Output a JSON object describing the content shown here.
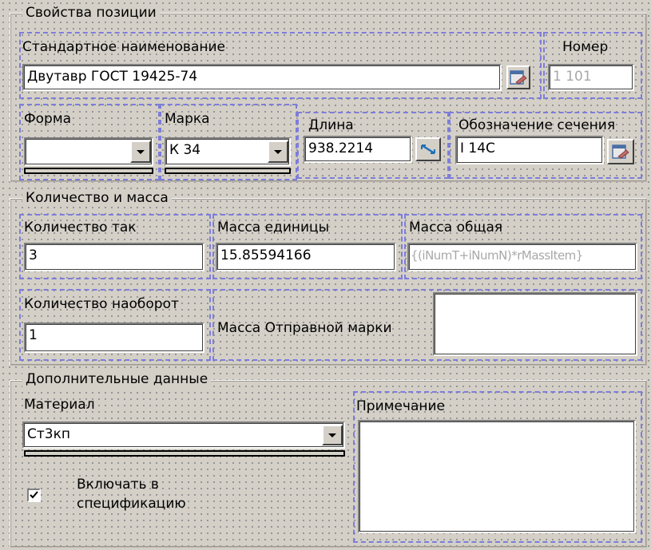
{
  "position": {
    "title": "Свойства позиции",
    "std_name_label": "Стандартное наименование",
    "std_name_value": "Двутавр ГОСТ 19425-74",
    "number_label": "Номер",
    "number_value": "1 101",
    "form_label": "Форма",
    "form_value": "",
    "mark_label": "Марка",
    "mark_value": "К 34",
    "length_label": "Длина",
    "length_value": "938.2214",
    "section_label": "Обозначение сечения",
    "section_value": "I 14С"
  },
  "quantity": {
    "title": "Количество и масса",
    "qty_label": "Количество так",
    "qty_value": "3",
    "unit_mass_label": "Масса единицы",
    "unit_mass_value": "15.85594166",
    "total_mass_label": "Масса общая",
    "total_mass_value": "{(iNumT+iNumN)*rMassItem}",
    "qty_rev_label": "Количество наоборот",
    "qty_rev_value": "1",
    "ship_mass_label": "Масса Отправной марки",
    "ship_mass_value": ""
  },
  "extra": {
    "title": "Дополнительные данные",
    "material_label": "Материал",
    "material_value": "Ст3кп",
    "note_label": "Примечание",
    "note_value": "",
    "include_label_1": "Включать в",
    "include_label_2": "спецификацию",
    "include_checked": true
  },
  "icons": {
    "dropdown": "chevron-down-icon",
    "catalog": "catalog-picker-icon",
    "measure": "measure-arrow-icon",
    "check": "check-icon"
  }
}
